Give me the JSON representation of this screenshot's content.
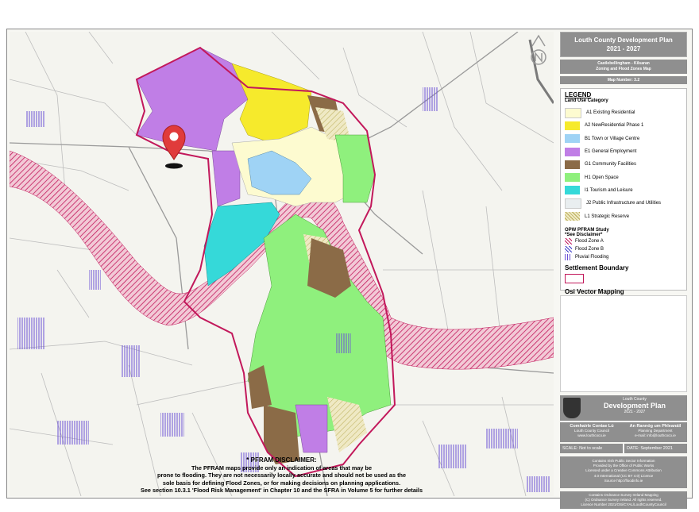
{
  "header": {
    "title_line1": "Louth County Development Plan",
    "title_line2": "2021 - 2027",
    "map_subtitle_1": "Castlebellingham - Kilsaran",
    "map_subtitle_2": "Zoning and Flood Zones Map",
    "map_number": "Map Number: 3.2"
  },
  "legend": {
    "title": "LEGEND",
    "category_title": "Land Use Category",
    "items": [
      {
        "label": "A1 Existing Residential",
        "color": "#fdfbd0"
      },
      {
        "label": "A2 NewResidential Phase 1",
        "color": "#f6ea2c"
      },
      {
        "label": "B1 Town or Village Centre",
        "color": "#9fd3f5"
      },
      {
        "label": "E1 General Employment",
        "color": "#c07ee6"
      },
      {
        "label": "G1 Community Facilities",
        "color": "#8b6b47"
      },
      {
        "label": "H1 Open Space",
        "color": "#8ff07d"
      },
      {
        "label": "I1 Tourism and Leisure",
        "color": "#35d9d9"
      },
      {
        "label": "J2 Public Infrastructure and Utilities",
        "color": "#e9eef0"
      },
      {
        "label": "L1 Strategic Reserve",
        "color": "#d8d08a"
      }
    ],
    "opw_title": "OPW PFRAM Study",
    "opw_sub": "*See Disclaimer*",
    "flood_items": [
      {
        "label": "Flood Zone A",
        "color": "#c2185b"
      },
      {
        "label": "Flood Zone B",
        "color": "#3a3ac8"
      },
      {
        "label": "Pluvial Flooding",
        "color": "#6a4fd6"
      }
    ],
    "settlement_boundary": "Settlement Boundary",
    "osi_vector": "Osi Vector Mapping"
  },
  "footer": {
    "logo_line1": "Louth County",
    "logo_line2": "Development Plan",
    "logo_line3": "2021 - 2027",
    "contact_left_title": "Comhairle Contae Lú",
    "contact_left_sub": "Louth County Council",
    "contact_left_web": "www.louthcoco.ie",
    "contact_right_title": "An Rannóg um Phleanáil",
    "contact_right_sub": "Planning Department",
    "contact_right_email": "e-mail: info@louthcoco.ie",
    "scale": "SCALE: Not to scale",
    "date": "DATE: September 2021",
    "info_lines": [
      "Contains Irish Public Sector Information",
      "Provided by the Office of Public Works",
      "Licensed under a Creative Commons Attribution",
      "4.0 International (CC BY 4.0) Licence",
      "Source http://floodinfo.ie"
    ],
    "copyright_lines": [
      "Contains Ordnance Survey Ireland Mapping",
      "(C) Ordnance Survey Ireland. All rights reserved.",
      "Licence Number 2021/OSi/CYAL/LouthCountyCouncil"
    ]
  },
  "disclaimer": {
    "title": "* PFRAM DISCLAIMER:",
    "lines": [
      "The PFRAM maps provide only an indication of areas that may be",
      "prone to flooding. They are not necessarily locally accurate and should not be used as the",
      "sole basis for defining Flood Zones, or for making decisions on planning applications.",
      "See section 10.3.1 'Flood Risk Management' in Chapter 10 and the SFRA in Volume 5 for further details"
    ]
  },
  "colors": {
    "boundary": "#c2185b",
    "marker": "#e03b3b",
    "panel_grey": "#8f8f8f"
  }
}
